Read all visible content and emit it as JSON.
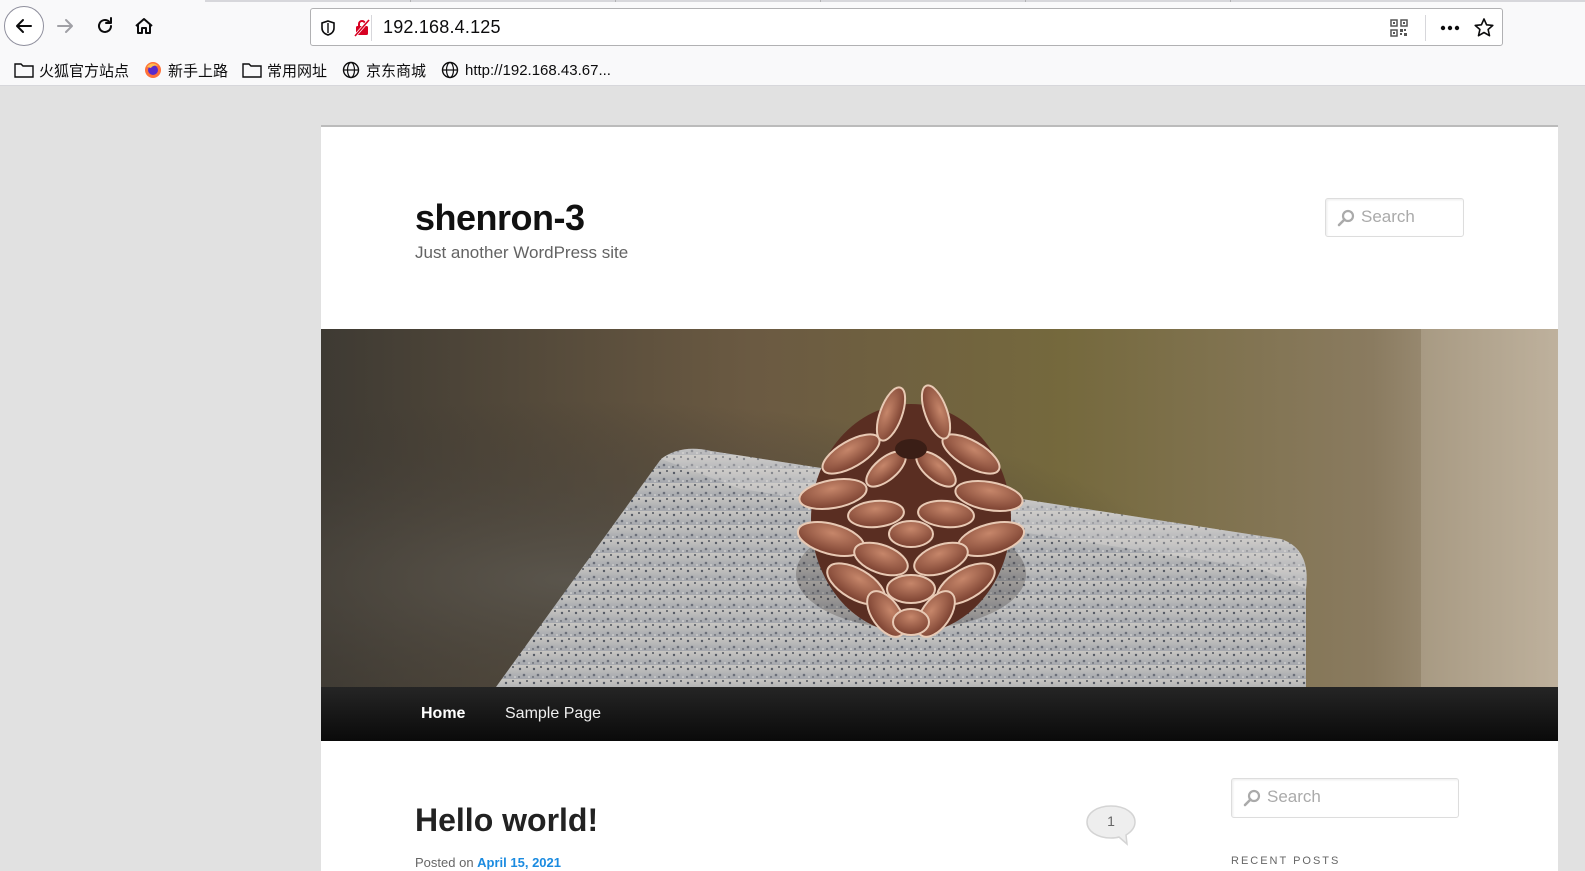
{
  "browser": {
    "url": "192.168.4.125",
    "bookmarks": [
      {
        "label": "火狐官方站点",
        "icon": "folder-icon"
      },
      {
        "label": "新手上路",
        "icon": "firefox-icon"
      },
      {
        "label": "常用网址",
        "icon": "folder-icon"
      },
      {
        "label": "京东商城",
        "icon": "globe-icon"
      },
      {
        "label": "http://192.168.43.67...",
        "icon": "globe-icon"
      }
    ]
  },
  "site": {
    "title": "shenron-3",
    "description": "Just another WordPress site",
    "search_placeholder": "Search"
  },
  "menu": [
    {
      "label": "Home",
      "current": true
    },
    {
      "label": "Sample Page",
      "current": false
    }
  ],
  "post": {
    "title": "Hello world!",
    "comment_count": "1",
    "meta_prefix": "Posted on",
    "meta_date": "April 15, 2021"
  },
  "sidebar": {
    "search_placeholder": "Search",
    "widget_title": "RECENT POSTS"
  }
}
